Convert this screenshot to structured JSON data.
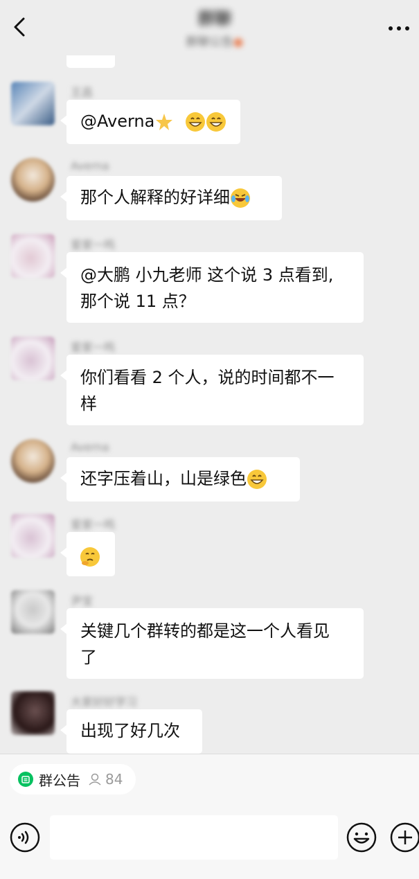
{
  "header": {
    "title": "群聊",
    "subtitle": "群聊公告"
  },
  "messages": [
    {
      "sender": "",
      "text": "",
      "emojis": [
        "orange-emoji"
      ]
    },
    {
      "sender": "",
      "text": "@Averna",
      "emojis": [
        "star-emoji",
        "grin-emoji",
        "grin-emoji"
      ]
    },
    {
      "sender": "",
      "text": "那个人解释的好详细",
      "emojis": [
        "laugh-cry-emoji"
      ]
    },
    {
      "sender": "",
      "text_lines": [
        "@大鹏 小九老师  这个说 3 点看到,",
        "那个说 11 点？"
      ]
    },
    {
      "sender": "",
      "text_lines": [
        "你们看看 2 个人，说的时间都不一",
        "样"
      ]
    },
    {
      "sender": "",
      "text": "还字压着山，山是绿色",
      "emojis": [
        "grin-emoji"
      ]
    },
    {
      "sender": "",
      "text": "",
      "emojis": [
        "hmm-emoji"
      ]
    },
    {
      "sender": "",
      "text_lines": [
        "关键几个群转的都是这一个人看见",
        "了"
      ]
    },
    {
      "sender": "",
      "text": "出现了好几次"
    }
  ],
  "bottom": {
    "notice_label": "群公告",
    "member_count": "84",
    "input_placeholder": ""
  },
  "colors": {
    "background": "#ededed",
    "bubble": "#ffffff",
    "accent_green": "#07c160"
  }
}
